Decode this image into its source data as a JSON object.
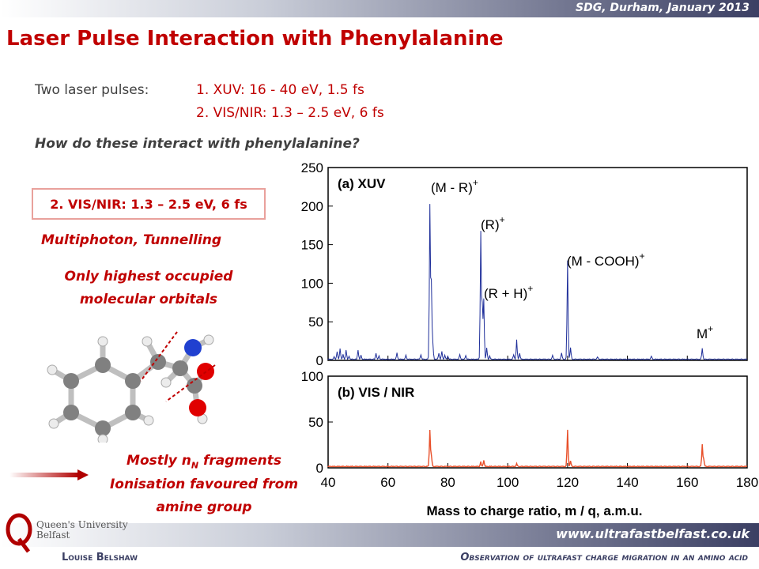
{
  "header": {
    "conference": "SDG, Durham, January 2013",
    "title": "Laser Pulse Interaction with Phenylalanine"
  },
  "pulses": {
    "label": "Two laser pulses:",
    "items": [
      "1. XUV: 16 - 40 eV, 1.5 fs",
      "2. VIS/NIR: 1.3 – 2.5 eV, 6 fs"
    ]
  },
  "question": "How do these interact with phenylalanine?",
  "box_text": "2. VIS/NIR: 1.3 – 2.5 eV, 6 fs",
  "mechanism": "Multiphoton, Tunnelling",
  "orbitals": {
    "line1": "Only highest occupied",
    "line2": "molecular orbitals"
  },
  "conclusion": {
    "line1_prefix": "Mostly n",
    "line1_sub": "N",
    "line1_suffix": " fragments",
    "line2": "Ionisation favoured from",
    "line3": "amine group"
  },
  "footer": {
    "url": "www.ultrafastbelfast.co.uk",
    "author": "Louise Belshaw",
    "topic": "Observation of ultrafast charge migration in an amino acid",
    "uni_line1": "Queen's University",
    "uni_line2": "Belfast"
  },
  "colors": {
    "accent": "#c00000",
    "xuv": "#1f2f9a",
    "vis": "#e8502a",
    "bar": "#3b3f63"
  },
  "chart_data": [
    {
      "type": "line",
      "panel": "(a) XUV",
      "ylim": [
        0,
        250
      ],
      "yticks": [
        0,
        50,
        100,
        150,
        200,
        250
      ],
      "xlim": [
        40,
        180
      ],
      "series": [
        {
          "peaks": [
            [
              42,
              3
            ],
            [
              43,
              10
            ],
            [
              44,
              14
            ],
            [
              45,
              6
            ],
            [
              46,
              12
            ],
            [
              47,
              4
            ],
            [
              50,
              12
            ],
            [
              51,
              5
            ],
            [
              56,
              8
            ],
            [
              57,
              4
            ],
            [
              63,
              8
            ],
            [
              66,
              5
            ],
            [
              71,
              6
            ],
            [
              74,
              200
            ],
            [
              74.5,
              100
            ],
            [
              75,
              20
            ],
            [
              77,
              8
            ],
            [
              78,
              10
            ],
            [
              79,
              5
            ],
            [
              80,
              4
            ],
            [
              84,
              6
            ],
            [
              86,
              5
            ],
            [
              91,
              165
            ],
            [
              91.5,
              70
            ],
            [
              92,
              78
            ],
            [
              93,
              15
            ],
            [
              94,
              4
            ],
            [
              102,
              6
            ],
            [
              103,
              25
            ],
            [
              104,
              8
            ],
            [
              115,
              5
            ],
            [
              118,
              8
            ],
            [
              120,
              128
            ],
            [
              121,
              15
            ],
            [
              130,
              3
            ],
            [
              148,
              4
            ],
            [
              165,
              14
            ]
          ]
        }
      ],
      "labels": [
        "(M - R)+",
        "(R)+",
        "(R + H)+",
        "(M - COOH)+",
        "M+"
      ]
    },
    {
      "type": "line",
      "panel": "(b) VIS / NIR",
      "ylim": [
        0,
        100
      ],
      "yticks": [
        0,
        50,
        100
      ],
      "xlim": [
        40,
        180
      ],
      "xticks": [
        40,
        60,
        80,
        100,
        120,
        140,
        160,
        180
      ],
      "xlabel": "Mass to charge ratio, m / q, a.m.u.",
      "series": [
        {
          "peaks": [
            [
              74,
              40
            ],
            [
              74.5,
              12
            ],
            [
              91,
              5
            ],
            [
              92,
              7
            ],
            [
              103,
              3
            ],
            [
              120,
              40
            ],
            [
              121,
              6
            ],
            [
              165,
              24
            ],
            [
              165.5,
              8
            ]
          ]
        }
      ]
    }
  ]
}
